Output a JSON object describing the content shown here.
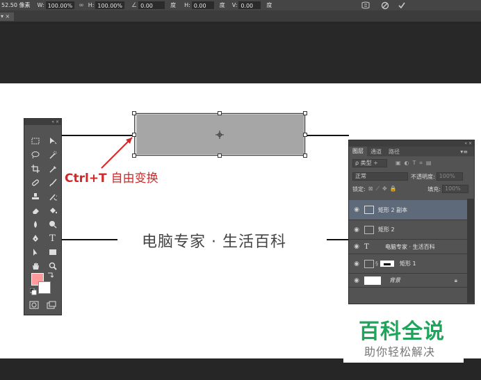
{
  "options_bar": {
    "x_value": "52.50 像素",
    "w_label": "W:",
    "w_value": "100.00%",
    "link_icon": "link-icon",
    "h_label": "H:",
    "h_value": "100.00%",
    "angle_icon": "angle-icon",
    "angle_value": "0.00",
    "angle_unit": "度",
    "hskew_label": "H:",
    "hskew_value": "0.00",
    "hskew_unit": "度",
    "vskew_label": "V:",
    "vskew_value": "0.00",
    "vskew_unit": "度",
    "warp_icon": "warp-icon",
    "cancel_icon": "cancel-icon",
    "commit_icon": "commit-check-icon"
  },
  "document_tab": {
    "label": "▾ ×"
  },
  "annotation": {
    "shortcut": "Ctrl+T",
    "text": "自由变换"
  },
  "caption": "电脑专家 · 生活百科",
  "toolbox": {
    "tools": [
      [
        "marquee-icon",
        "move-icon"
      ],
      [
        "lasso-icon",
        "quick-select-icon"
      ],
      [
        "crop-icon",
        "eyedropper-icon"
      ],
      [
        "healing-icon",
        "brush-icon"
      ],
      [
        "stamp-icon",
        "history-brush-icon"
      ],
      [
        "eraser-icon",
        "paint-bucket-icon"
      ],
      [
        "blur-icon",
        "dodge-icon"
      ],
      [
        "pen-icon",
        "type-icon"
      ],
      [
        "path-select-icon",
        "shape-icon"
      ],
      [
        "hand-icon",
        "zoom-icon"
      ]
    ],
    "type_glyph": "T",
    "foreground_color": "#ff9b9b",
    "background_color": "#ffffff"
  },
  "layers_panel": {
    "tabs": [
      "图层",
      "通道",
      "路径"
    ],
    "filter_label": "ρ 类型 ÷",
    "blend_mode": "正常",
    "opacity_label": "不透明度:",
    "opacity_value": "100%",
    "lock_label": "锁定:",
    "fill_label": "填充:",
    "fill_value": "100%",
    "layers": [
      {
        "name": "矩形 2 副本",
        "selected": true
      },
      {
        "name": "矩形 2",
        "selected": false
      },
      {
        "name": "电脑专家 · 生活百科",
        "selected": false
      },
      {
        "name": "矩形 1",
        "selected": false
      },
      {
        "name": "背景",
        "selected": false
      }
    ]
  },
  "watermark": {
    "title": "百科全说",
    "subtitle": "助你轻松解决"
  },
  "colors": {
    "accent_red": "#d02828",
    "watermark_green": "#1fa55b",
    "rect_gray": "#a6a6a6"
  }
}
